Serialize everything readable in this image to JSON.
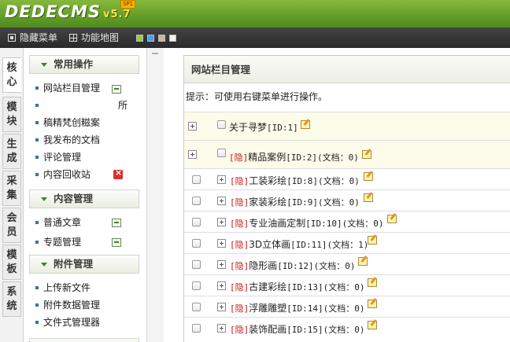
{
  "header": {
    "logo_text": "DEDECMS",
    "version": "v5.7",
    "badge": "SP1"
  },
  "menubar": {
    "hide_menu": "隐藏菜单",
    "function_map": "功能地图",
    "skin_colors": [
      "#9ccc3c",
      "#4aa0e0",
      "#c9b79a",
      "#f2f2f2"
    ]
  },
  "vtabs": [
    "核\n心",
    "模\n块",
    "生\n成",
    "采\n集",
    "会\n员",
    "模\n板",
    "系\n统"
  ],
  "sidebar": {
    "section1": "常用操作",
    "items1": [
      "网站栏目管理",
      "所",
      "稿精梵创糍案",
      "我发布的文档",
      "评论管理",
      "内容回收站"
    ],
    "section2": "内容管理",
    "items2": [
      "普通文章",
      "专题管理"
    ],
    "section3": "附件管理",
    "items3": [
      "上传新文件",
      "附件数据管理",
      "文件式管理器"
    ]
  },
  "main": {
    "title": "网站栏目管理",
    "tip": "提示：可使用右键菜单进行操作。",
    "hidden_tag": "[隐]",
    "rows": [
      {
        "name": "关于寻梦",
        "id": "[ID:1]",
        "docs": ""
      },
      {
        "name": "精品案例",
        "id": "[ID:2]",
        "docs": "(文档：0)"
      },
      {
        "name": "工装彩绘",
        "id": "[ID:8]",
        "docs": "(文档：0)"
      },
      {
        "name": "家装彩绘",
        "id": "[ID:9]",
        "docs": "(文档：0)"
      },
      {
        "name": "专业油画定制",
        "id": "[ID:10]",
        "docs": "(文档：0)"
      },
      {
        "name": "3D立体画",
        "id": "[ID:11]",
        "docs": "(文档：1)"
      },
      {
        "name": "隐形画",
        "id": "[ID:12]",
        "docs": "(文档：0)"
      },
      {
        "name": "古建彩绘",
        "id": "[ID:13]",
        "docs": "(文档：0)"
      },
      {
        "name": "浮雕雕塑",
        "id": "[ID:14]",
        "docs": "(文档：0)"
      },
      {
        "name": "装饰配画",
        "id": "[ID:15]",
        "docs": "(文档：0)"
      }
    ]
  }
}
